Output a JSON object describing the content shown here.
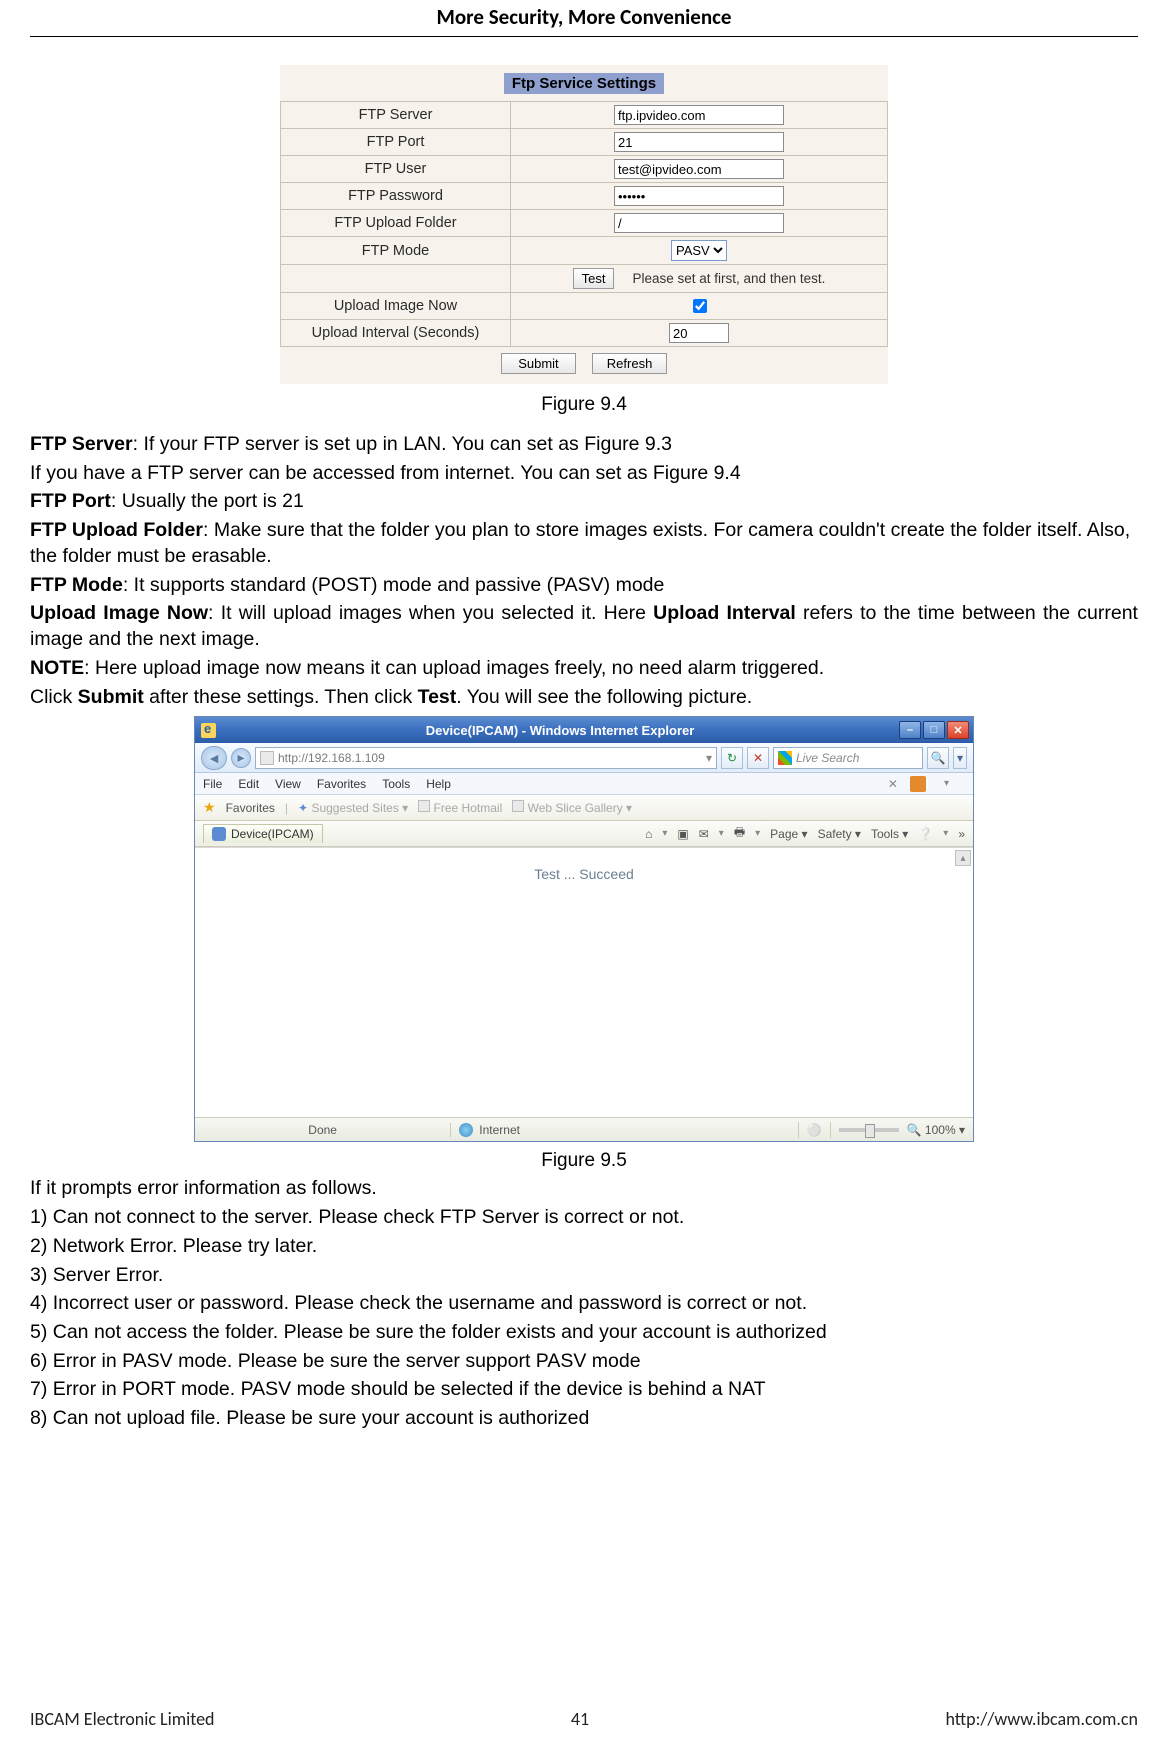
{
  "pageHeader": "More Security, More Convenience",
  "ftpTable": {
    "title": "Ftp Service Settings",
    "rows": {
      "server": {
        "label": "FTP Server",
        "value": "ftp.ipvideo.com"
      },
      "port": {
        "label": "FTP Port",
        "value": "21"
      },
      "user": {
        "label": "FTP User",
        "value": "test@ipvideo.com"
      },
      "password": {
        "label": "FTP Password",
        "value": "••••••"
      },
      "folder": {
        "label": "FTP Upload Folder",
        "value": "/"
      },
      "mode": {
        "label": "FTP Mode",
        "value": "PASV"
      },
      "upload": {
        "label": "Upload Image Now",
        "checked": true
      },
      "interval": {
        "label": "Upload Interval (Seconds)",
        "value": "20"
      }
    },
    "testButton": "Test",
    "testHint": "Please set at first, and then test.",
    "submitButton": "Submit",
    "refreshButton": "Refresh"
  },
  "figure1Caption": "Figure 9.4",
  "body1": {
    "l1a": "FTP Server",
    "l1b": ": If your FTP server is set up in LAN. You can set as Figure 9.3",
    "l2": "If you have a FTP server can be accessed from internet. You can set as Figure 9.4",
    "l3a": "FTP Port",
    "l3b": ": Usually the port is 21",
    "l4a": "FTP Upload Folder",
    "l4b": ": Make sure that the folder you plan to store images exists. For camera couldn't create the folder itself. Also, the folder must be erasable.",
    "l5a": "FTP Mode",
    "l5b": ": It supports standard (POST) mode and passive (PASV) mode",
    "l6a": "Upload Image Now",
    "l6b": ": It will upload images when you selected it. Here ",
    "l6c": "Upload Interval",
    "l6d": " refers to the time between the current image and the next image.",
    "l7a": "NOTE",
    "l7b": ": Here upload image now means it can upload images freely, no need alarm triggered.",
    "l8a": "Click ",
    "l8b": "Submit",
    "l8c": " after these settings. Then click ",
    "l8d": "Test",
    "l8e": ". You will see the following picture."
  },
  "ie": {
    "title": "Device(IPCAM) - Windows Internet Explorer",
    "url": "http://192.168.1.109",
    "searchPlaceholder": "Live Search",
    "menu": {
      "file": "File",
      "edit": "Edit",
      "view": "View",
      "favorites": "Favorites",
      "tools": "Tools",
      "help": "Help",
      "x": "✕",
      "openArrow": "▾"
    },
    "favbar": {
      "label": "Favorites",
      "suggested": "Suggested Sites ▾",
      "hotmail": "Free Hotmail",
      "slice": "Web Slice Gallery ▾"
    },
    "tab": {
      "name": "Device(IPCAM)",
      "home": "⌂",
      "feed": "▣",
      "mail": "✉",
      "print": "🖶",
      "page": "Page ▾",
      "safety": "Safety ▾",
      "tools": "Tools ▾",
      "help": "❔",
      "more": "»"
    },
    "content": "Test  ...  Succeed",
    "status": {
      "done": "Done",
      "zone": "Internet",
      "mode": "⚪",
      "zoom": "100% ▾"
    }
  },
  "figure2Caption": "Figure 9.5",
  "body2": {
    "intro": "If it prompts error information as follows.",
    "e1": "1) Can not connect to the server. Please check FTP Server is correct or not.",
    "e2": "2) Network Error. Please try later.",
    "e3": "3) Server Error.",
    "e4": "4) Incorrect user or password. Please check the username and password is correct or not.",
    "e5": "5) Can not access the folder. Please be sure the folder exists and your account is authorized",
    "e6": "6) Error in PASV mode. Please be sure the server support PASV mode",
    "e7": "7) Error in PORT mode. PASV mode should be selected if the device is behind a NAT",
    "e8": "8) Can not upload file. Please be sure your account is authorized"
  },
  "footer": {
    "left": "IBCAM Electronic Limited",
    "center": "41",
    "right": "http://www.ibcam.com.cn"
  }
}
